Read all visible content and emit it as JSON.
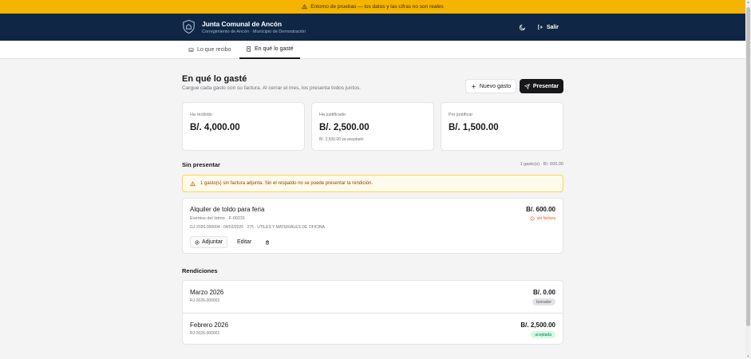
{
  "banner": {
    "text": "Entorno de pruebas — los datos y las cifras no son reales"
  },
  "header": {
    "title": "Junta Comunal de Ancón",
    "subtitle": "Corregimiento de Ancón · Municipio de Demostración",
    "logout_label": "Salir"
  },
  "tabs": [
    {
      "label": "Lo que recibo",
      "icon": "inbox-icon",
      "active": false
    },
    {
      "label": "En qué lo gasté",
      "icon": "receipt-icon",
      "active": true
    }
  ],
  "page": {
    "title": "En qué lo gasté",
    "subtitle": "Cargue cada gasto con su factura. Al cerrar el mes, los presenta todos juntos.",
    "new_expense_label": "Nuevo gasto",
    "present_label": "Presentar"
  },
  "stats": [
    {
      "label": "Ha recibido",
      "value": "B/. 4,000.00",
      "note": ""
    },
    {
      "label": "Ha justificado",
      "value": "B/. 2,500.00",
      "note": "B/. 2,500.00 ya aceptado"
    },
    {
      "label": "Por justificar",
      "value": "B/. 1,500.00",
      "note": ""
    }
  ],
  "unsubmitted": {
    "title": "Sin presentar",
    "meta": "1 gasto(s) · B/. 600.00",
    "warning": "1 gasto(s) sin factura adjunta. Sin el respaldo no se puede presentar la rendición.",
    "expense": {
      "title": "Alquiler de toldo para feria",
      "subtitle": "Eventos del Istmo · F-00231",
      "meta": "GJ-2026-000004 · 04/03/2026 · 275 · UTILES Y MATERIALES DE OFICINA",
      "amount": "B/. 600.00",
      "flag": "sin factura",
      "attach_label": "Adjuntar",
      "edit_label": "Editar"
    }
  },
  "renditions": {
    "title": "Rendiciones",
    "items": [
      {
        "title": "Marzo 2026",
        "code": "RJ-2026-000002",
        "amount": "B/. 0.00",
        "status": "borrador"
      },
      {
        "title": "Febrero 2026",
        "code": "RJ-2026-000001",
        "amount": "B/. 2,500.00",
        "status": "aceptada"
      }
    ]
  },
  "colors": {
    "banner": "#f4b400",
    "header": "#0f2744",
    "primary": "#18181b",
    "warning": "#ea580c",
    "success": "#047857"
  }
}
